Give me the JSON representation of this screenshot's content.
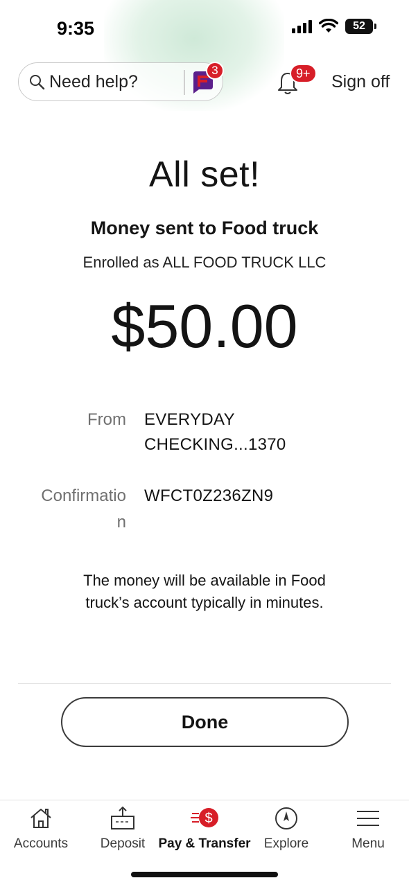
{
  "status_bar": {
    "time": "9:35",
    "battery": "52"
  },
  "header": {
    "help_placeholder": "Need help?",
    "assistant_badge": "3",
    "notification_badge": "9+",
    "sign_off": "Sign off"
  },
  "confirmation": {
    "title": "All set!",
    "subtitle": "Money sent to Food truck",
    "enrolled": "Enrolled as ALL FOOD TRUCK LLC",
    "amount": "$50.00",
    "from_label": "From",
    "from_value_line1": "EVERYDAY",
    "from_value_line2": "CHECKING...1370",
    "confirmation_label_line1": "Confirmatio",
    "confirmation_label_line2": "n",
    "confirmation_value": "WFCT0Z236ZN9",
    "note": "The money will be available in Food truck’s account typically in minutes.",
    "done_label": "Done"
  },
  "bottom_nav": {
    "items": [
      {
        "label": "Accounts",
        "icon": "home-icon",
        "active": false
      },
      {
        "label": "Deposit",
        "icon": "deposit-icon",
        "active": false
      },
      {
        "label": "Pay & Transfer",
        "icon": "pay-transfer-icon",
        "active": true
      },
      {
        "label": "Explore",
        "icon": "compass-icon",
        "active": false
      },
      {
        "label": "Menu",
        "icon": "menu-icon",
        "active": false
      }
    ]
  },
  "colors": {
    "brand_red": "#d71e28",
    "assistant_purple": "#5a1f8a"
  }
}
